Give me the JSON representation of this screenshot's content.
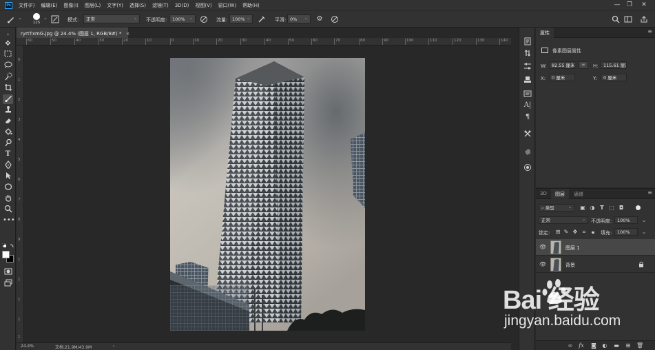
{
  "menu": {
    "app_logo": "Ps",
    "items": [
      "文件(F)",
      "编辑(E)",
      "图像(I)",
      "图层(L)",
      "文字(Y)",
      "选择(S)",
      "滤镜(T)",
      "3D(D)",
      "视图(V)",
      "窗口(W)",
      "帮助(H)"
    ],
    "window_controls": [
      "—",
      "❐",
      "✕"
    ]
  },
  "options": {
    "brush_size": "125",
    "mode_label": "模式:",
    "mode_value": "正常",
    "opacity_label": "不透明度:",
    "opacity_value": "100%",
    "flow_label": "流量:",
    "flow_value": "100%",
    "smoothing_label": "平滑:",
    "smoothing_value": "0%"
  },
  "document": {
    "tab_title": "ryrtTxmG.jpg @ 24.4% (图层 1, RGB/8#) *",
    "tab_close": "×",
    "ruler_h": [
      "60",
      "50",
      "40",
      "30",
      "20",
      "10",
      "0",
      "10",
      "20",
      "30",
      "40",
      "50",
      "60",
      "70",
      "80",
      "90",
      "100",
      "110",
      "120",
      "130",
      "140"
    ],
    "ruler_v": [
      "0",
      "1",
      "2",
      "3",
      "4",
      "5",
      "6",
      "7",
      "8",
      "9",
      "1",
      "1",
      "1",
      "1",
      "1"
    ],
    "status_zoom": "24.4%",
    "status_doc": "文档:21.9M/43.9M",
    "status_arrow": "›"
  },
  "properties": {
    "tab_label": "属性",
    "section_title": "像素图层属性",
    "w_label": "W:",
    "w_value": "82.55 厘米",
    "h_label": "H:",
    "h_value": "115.61 厘米",
    "x_label": "X:",
    "x_value": "0 厘米",
    "y_label": "Y:",
    "y_value": "0 厘米"
  },
  "layers_panel": {
    "tabs": [
      "3D",
      "图层",
      "通道"
    ],
    "active_tab": "图层",
    "kind_filter": "类型",
    "blend_mode": "正常",
    "opacity_label": "不透明度:",
    "opacity_value": "100%",
    "lock_label": "锁定:",
    "fill_label": "填充:",
    "fill_value": "100%",
    "layers": [
      {
        "name": "图层 1",
        "selected": true,
        "locked": false
      },
      {
        "name": "背景",
        "selected": false,
        "locked": true
      }
    ]
  },
  "watermark": {
    "line1": "Bai 经验",
    "line2": "jingyan.baidu.com"
  }
}
